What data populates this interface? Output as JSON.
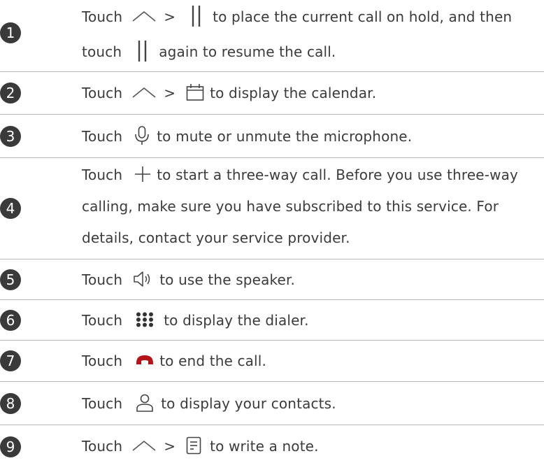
{
  "steps": [
    {
      "number": "1",
      "lines": [
        {
          "w1": "Touch",
          "sep": ">",
          "w2": "to place the current call on hold, and then"
        },
        {
          "w1": "touch",
          "w2": "again to resume the call."
        }
      ],
      "icons": [
        "chevron-up-icon",
        "pause-icon",
        "pause-icon"
      ]
    },
    {
      "number": "2",
      "w1": "Touch",
      "sep": ">",
      "w2": "to display the calendar.",
      "icons": [
        "chevron-up-icon",
        "calendar-icon"
      ]
    },
    {
      "number": "3",
      "w1": "Touch",
      "w2": "to mute or unmute the microphone.",
      "icons": [
        "microphone-icon"
      ]
    },
    {
      "number": "4",
      "lines": [
        {
          "w1": "Touch",
          "w2": "to start a three-way call. Before you use three-way"
        },
        {
          "text": "calling, make sure you have subscribed to this service. For"
        },
        {
          "text": "details, contact your service provider."
        }
      ],
      "icons": [
        "add-call-icon"
      ]
    },
    {
      "number": "5",
      "w1": "Touch",
      "w2": "to use the speaker.",
      "icons": [
        "speaker-icon"
      ]
    },
    {
      "number": "6",
      "w1": "Touch",
      "w2": "to display the dialer.",
      "icons": [
        "dialpad-icon"
      ]
    },
    {
      "number": "7",
      "w1": "Touch",
      "w2": "to end the call.",
      "icons": [
        "end-call-icon"
      ]
    },
    {
      "number": "8",
      "w1": "Touch",
      "w2": "to display your contacts.",
      "icons": [
        "contacts-icon"
      ]
    },
    {
      "number": "9",
      "w1": "Touch",
      "sep": ">",
      "w2": "to write a note.",
      "icons": [
        "chevron-up-icon",
        "note-icon"
      ]
    }
  ],
  "colors": {
    "text": "#3b3b3b",
    "badge": "#3a3a3a",
    "divider": "#b8b8b8",
    "end_call": "#b3151b"
  }
}
